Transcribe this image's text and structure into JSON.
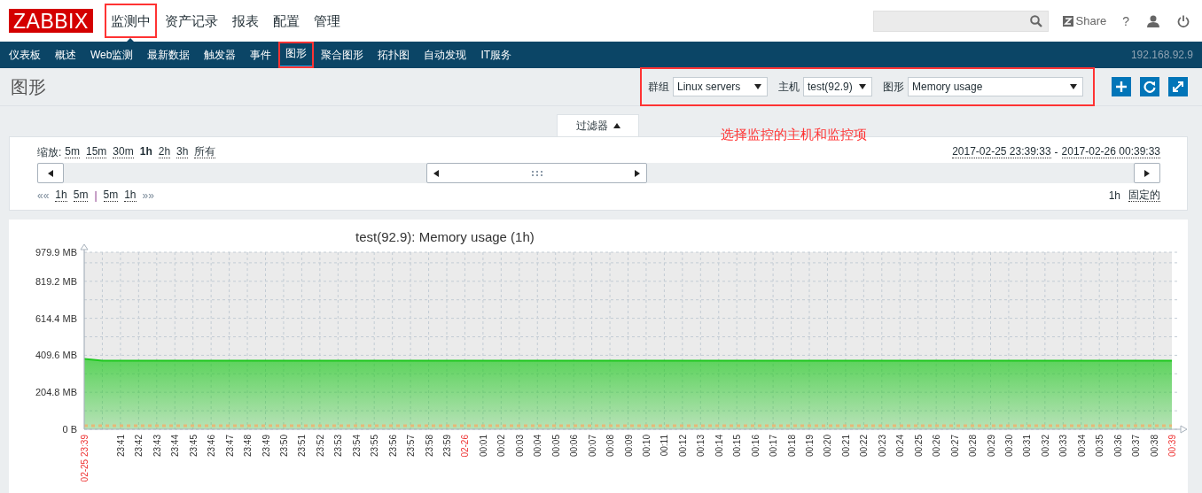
{
  "header": {
    "logo": "ZABBIX",
    "menu": [
      {
        "label": "监测中",
        "selected": true,
        "highlighted": true
      },
      {
        "label": "资产记录",
        "selected": false,
        "highlighted": false
      },
      {
        "label": "报表",
        "selected": false,
        "highlighted": false
      },
      {
        "label": "配置",
        "selected": false,
        "highlighted": false
      },
      {
        "label": "管理",
        "selected": false,
        "highlighted": false
      }
    ],
    "share": "Share",
    "help": "?"
  },
  "submenu": {
    "items": [
      {
        "label": "仪表板",
        "selected": false,
        "highlighted": false
      },
      {
        "label": "概述",
        "selected": false,
        "highlighted": false
      },
      {
        "label": "Web监测",
        "selected": false,
        "highlighted": false
      },
      {
        "label": "最新数据",
        "selected": false,
        "highlighted": false
      },
      {
        "label": "触发器",
        "selected": false,
        "highlighted": false
      },
      {
        "label": "事件",
        "selected": false,
        "highlighted": false
      },
      {
        "label": "图形",
        "selected": true,
        "highlighted": true
      },
      {
        "label": "聚合图形",
        "selected": false,
        "highlighted": false
      },
      {
        "label": "拓扑图",
        "selected": false,
        "highlighted": false
      },
      {
        "label": "自动发现",
        "selected": false,
        "highlighted": false
      },
      {
        "label": "IT服务",
        "selected": false,
        "highlighted": false
      }
    ],
    "server": "192.168.92.9"
  },
  "page": {
    "title": "图形",
    "filters_highlighted": true,
    "filters": [
      {
        "label": "群组",
        "value": "Linux servers"
      },
      {
        "label": "主机",
        "value": "test(92.9)"
      },
      {
        "label": "图形",
        "value": "Memory usage"
      }
    ]
  },
  "filter_tab": {
    "label": "过滤器",
    "expanded": true
  },
  "annotation": "选择监控的主机和监控项",
  "timeline": {
    "zoom_label": "缩放:",
    "zoom": [
      {
        "label": "5m",
        "selected": false
      },
      {
        "label": "15m",
        "selected": false
      },
      {
        "label": "30m",
        "selected": false
      },
      {
        "label": "1h",
        "selected": true
      },
      {
        "label": "2h",
        "selected": false
      },
      {
        "label": "3h",
        "selected": false
      },
      {
        "label": "所有",
        "selected": false
      }
    ],
    "range_from": "2017-02-25 23:39:33",
    "range_sep": "-",
    "range_to": "2017-02-26 00:39:33",
    "back_mark": "««",
    "back": [
      "1h",
      "5m"
    ],
    "separator": "|",
    "forward": [
      "5m",
      "1h"
    ],
    "forward_mark": "»»",
    "period": "1h",
    "fixed": "固定的"
  },
  "graph": {
    "chart_data": {
      "type": "area",
      "title": "test(92.9): Memory usage (1h)",
      "categories": [
        "02-25 23:39",
        null,
        "23:41",
        "23:42",
        "23:43",
        "23:44",
        "23:45",
        "23:46",
        "23:47",
        "23:48",
        "23:49",
        "23:50",
        "23:51",
        "23:52",
        "23:53",
        "23:54",
        "23:55",
        "23:56",
        "23:57",
        "23:58",
        "23:59",
        "02-26",
        "00:01",
        "00:02",
        "00:03",
        "00:04",
        "00:05",
        "00:06",
        "00:07",
        "00:08",
        "00:09",
        "00:10",
        "00:11",
        "00:12",
        "00:13",
        "00:14",
        "00:15",
        "00:16",
        "00:17",
        "00:18",
        "00:19",
        "00:20",
        "00:21",
        "00:22",
        "00:23",
        "00:24",
        "00:25",
        "00:26",
        "00:27",
        "00:28",
        "00:29",
        "00:30",
        "00:31",
        "00:32",
        "00:33",
        "00:34",
        "00:35",
        "00:36",
        "00:37",
        "00:38",
        "00:39"
      ],
      "series": [
        {
          "type": "area",
          "color": "#1ec81e",
          "values": [
            390,
            380,
            380,
            380,
            380,
            380,
            380,
            380,
            380,
            380,
            380,
            380,
            380,
            380,
            380,
            380,
            380,
            380,
            380,
            380,
            380,
            380,
            380,
            380,
            380,
            380,
            380,
            380,
            380,
            380,
            380,
            380,
            380,
            380,
            380,
            380,
            380,
            380,
            380,
            380,
            380,
            380,
            380,
            380,
            380,
            380,
            380,
            380,
            380,
            380,
            380,
            380,
            380,
            380,
            380,
            380,
            380,
            380,
            380,
            380,
            380
          ]
        },
        {
          "type": "line",
          "line_style": "dashed",
          "color": "#e6b878",
          "values": [
            20,
            20,
            20,
            20,
            20,
            20,
            20,
            20,
            20,
            20,
            20,
            20,
            20,
            20,
            20,
            20,
            20,
            20,
            20,
            20,
            20,
            20,
            20,
            20,
            20,
            20,
            20,
            20,
            20,
            20,
            20,
            20,
            20,
            20,
            20,
            20,
            20,
            20,
            20,
            20,
            20,
            20,
            20,
            20,
            20,
            20,
            20,
            20,
            20,
            20,
            20,
            20,
            20,
            20,
            20,
            20,
            20,
            20,
            20,
            20,
            20
          ]
        }
      ],
      "ylim": [
        0,
        979.9
      ],
      "grid": true,
      "yticks": [
        {
          "value": 0,
          "label": "0 B"
        },
        {
          "value": 204.8,
          "label": "204.8 MB"
        },
        {
          "value": 409.6,
          "label": "409.6 MB"
        },
        {
          "value": 614.4,
          "label": "614.4 MB"
        },
        {
          "value": 819.2,
          "label": "819.2 MB"
        },
        {
          "value": 979.9,
          "label": "979.9 MB"
        }
      ]
    }
  }
}
